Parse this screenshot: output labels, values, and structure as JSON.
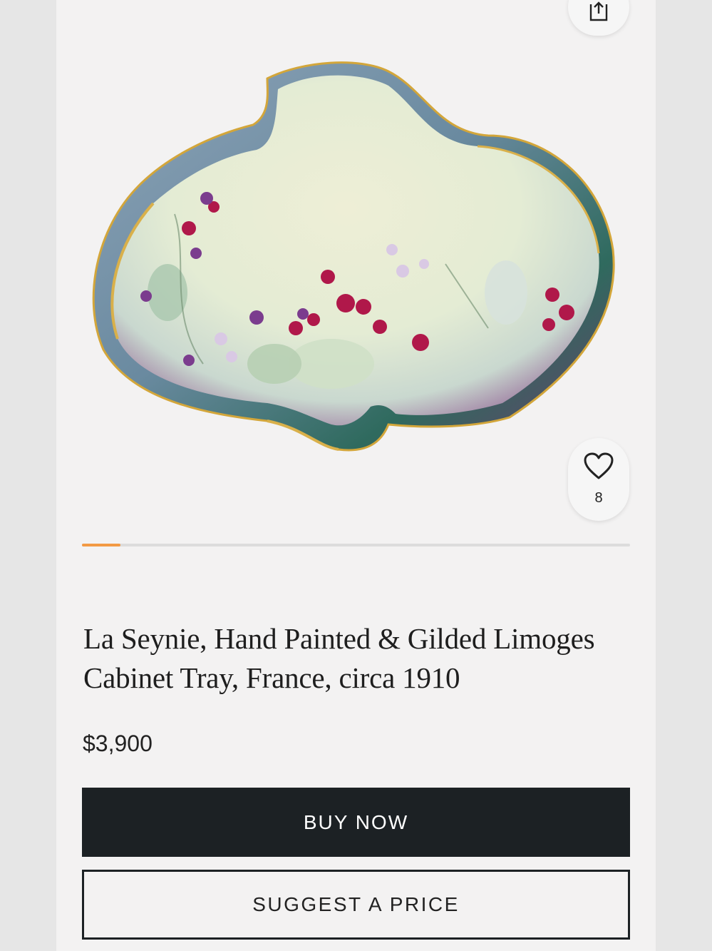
{
  "listing": {
    "title": "La Seynie, Hand Painted & Gilded Limoges Cabinet Tray, France, circa 1910",
    "price": "$3,900",
    "favorite_count": "8",
    "gallery_progress": 0.07
  },
  "actions": {
    "buy_now_label": "BUY NOW",
    "suggest_price_label": "SUGGEST A PRICE"
  },
  "icons": {
    "share": "share-icon",
    "favorite": "heart-icon"
  },
  "colors": {
    "accent": "#f29a44",
    "button_dark": "#1c2124",
    "background": "#f3f2f2"
  }
}
